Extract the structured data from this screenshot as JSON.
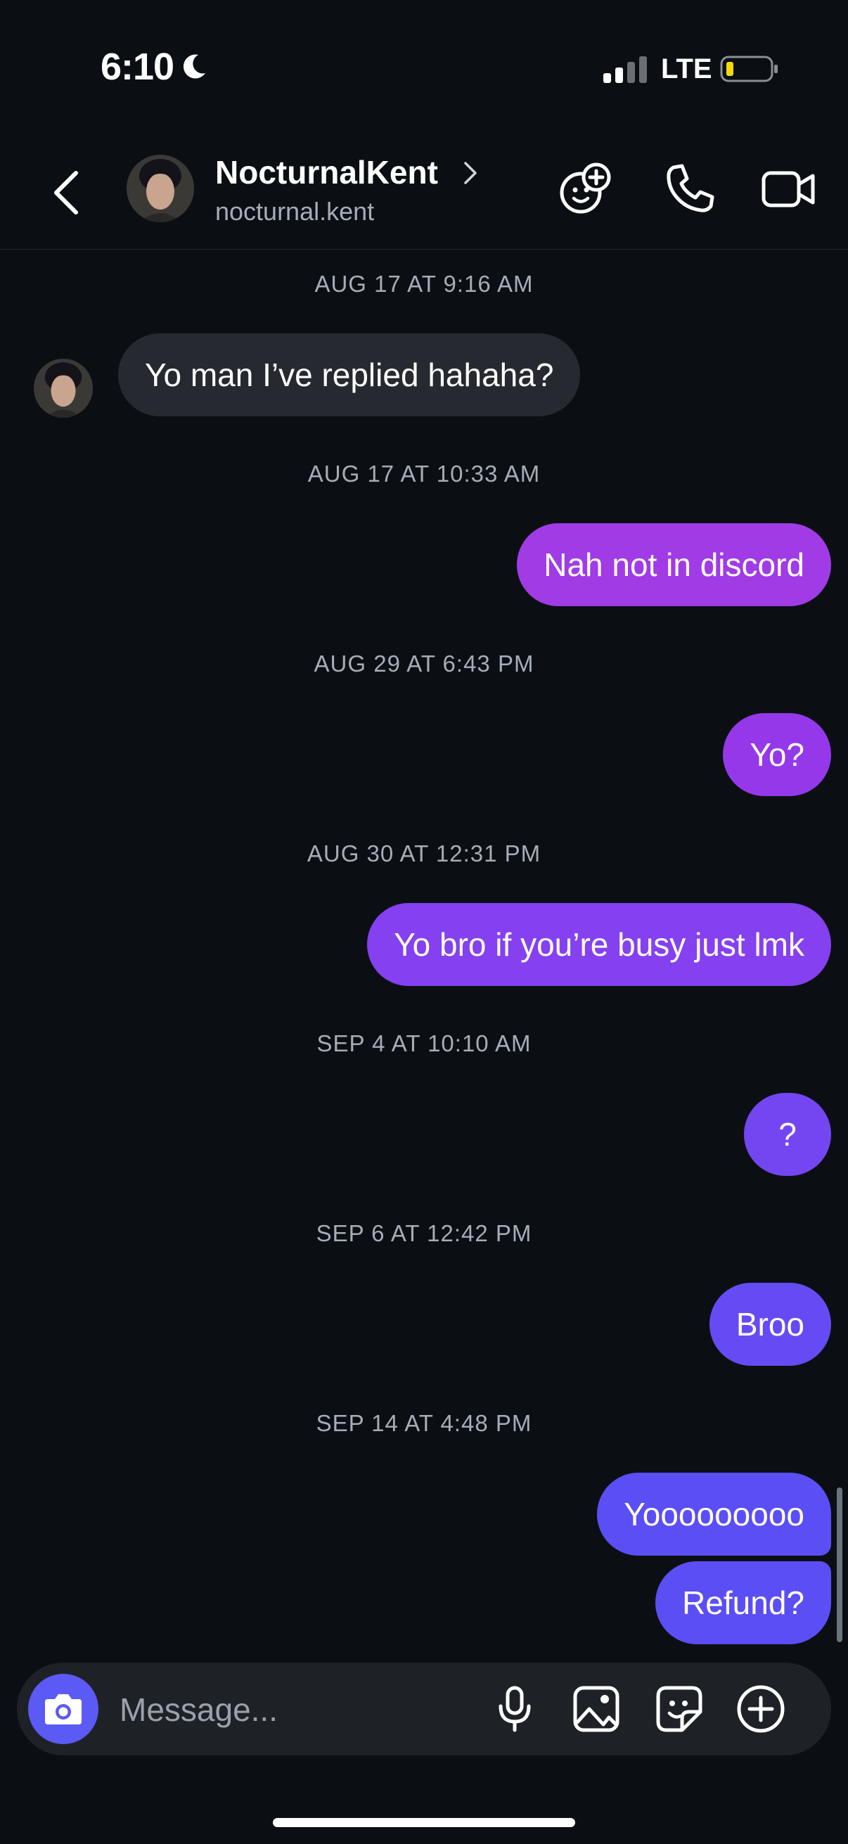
{
  "status": {
    "time": "6:10",
    "network": "LTE"
  },
  "contact": {
    "name": "NocturnalKent",
    "handle": "nocturnal.kent"
  },
  "messages": [
    {
      "timestamp": "AUG 17 AT 9:16 AM",
      "text": "Yo man I’ve replied hahaha?",
      "from": "them"
    },
    {
      "timestamp": "AUG 17 AT 10:33 AM",
      "text": "Nah not in discord",
      "from": "me"
    },
    {
      "timestamp": "AUG 29 AT 6:43 PM",
      "text": "Yo?",
      "from": "me"
    },
    {
      "timestamp": "AUG 30 AT 12:31 PM",
      "text": "Yo bro if you’re busy just lmk",
      "from": "me"
    },
    {
      "timestamp": "SEP 4 AT 10:10 AM",
      "text": "?",
      "from": "me"
    },
    {
      "timestamp": "SEP 6 AT 12:42 PM",
      "text": "Broo",
      "from": "me"
    },
    {
      "timestamp": "SEP 14 AT 4:48 PM",
      "text": "Yooooooooo",
      "from": "me"
    },
    {
      "timestamp": "",
      "text": "Refund?",
      "from": "me"
    }
  ],
  "composer": {
    "placeholder": "Message..."
  },
  "colors": {
    "background": "#0b0f14",
    "incoming_bubble": "#262a30",
    "outgoing_gradient_top": "#9b3be3",
    "outgoing_gradient_bottom": "#5b4ef5",
    "accent": "#5b5af5"
  },
  "icons": [
    "moon-icon",
    "signal-icon",
    "battery-icon",
    "back-icon",
    "chevron-right-icon",
    "sticker-plus-icon",
    "phone-icon",
    "video-icon",
    "camera-icon",
    "microphone-icon",
    "gallery-icon",
    "sticker-icon",
    "add-circle-icon"
  ]
}
